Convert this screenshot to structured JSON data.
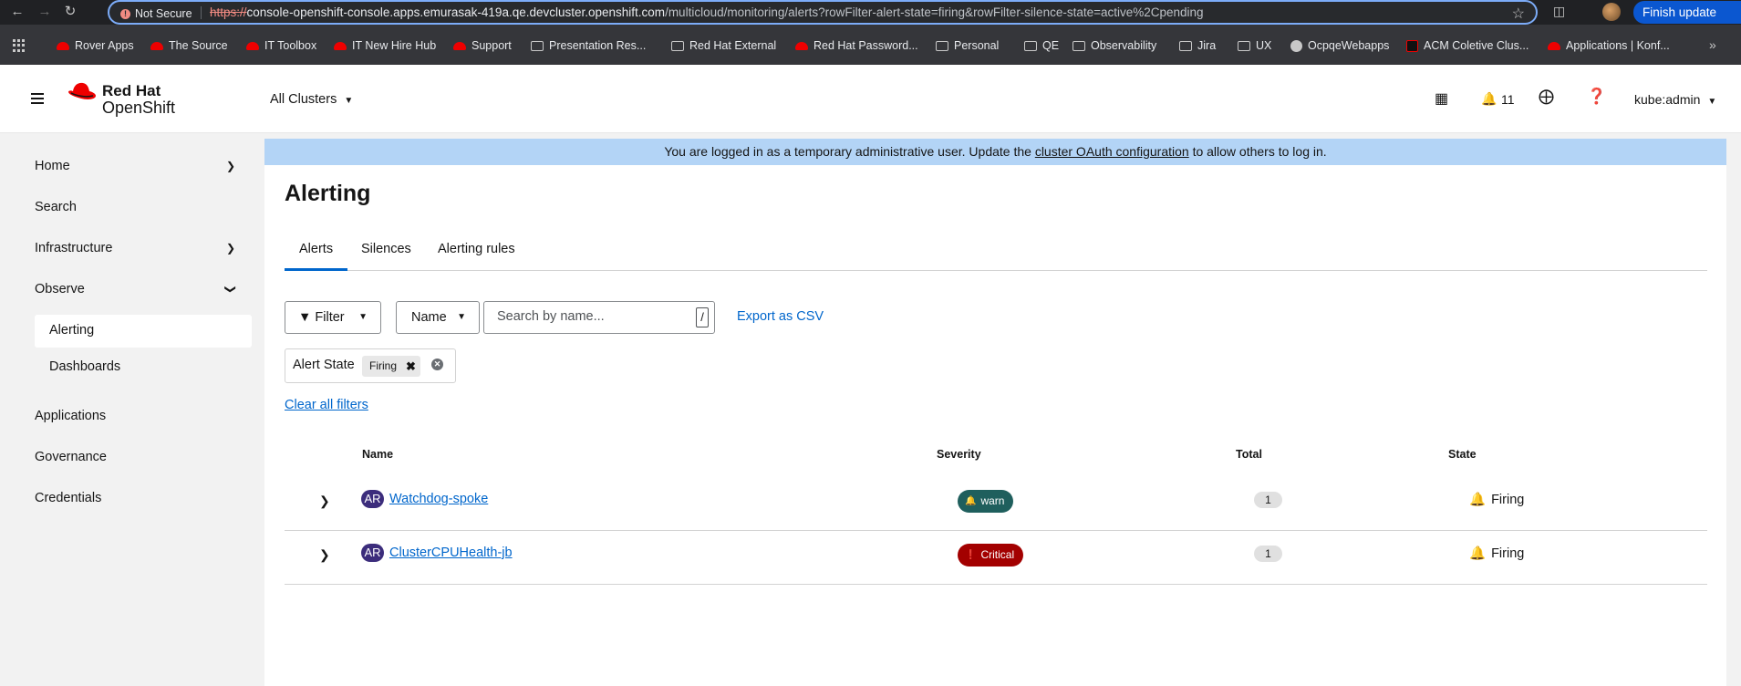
{
  "browser": {
    "security_label": "Not Secure",
    "url_scheme": "https://",
    "url_host": "console-openshift-console.apps.emurasak-419a.qe.devcluster.openshift.com",
    "url_path": "/multicloud/monitoring/alerts?rowFilter-alert-state=firing&rowFilter-silence-state=active%2Cpending",
    "finish_update_label": "Finish update"
  },
  "bookmarks": [
    {
      "label": "Rover Apps",
      "icon": "redhat-icon"
    },
    {
      "label": "The Source",
      "icon": "redhat-icon"
    },
    {
      "label": "IT Toolbox",
      "icon": "redhat-icon"
    },
    {
      "label": "IT New Hire Hub",
      "icon": "redhat-icon"
    },
    {
      "label": "Support",
      "icon": "redhat-icon"
    },
    {
      "label": "Presentation Res...",
      "icon": "folder-icon"
    },
    {
      "label": "Red Hat External",
      "icon": "folder-icon"
    },
    {
      "label": "Red Hat Password...",
      "icon": "redhat-icon"
    },
    {
      "label": "Personal",
      "icon": "folder-icon"
    },
    {
      "label": "QE",
      "icon": "folder-icon"
    },
    {
      "label": "Observability",
      "icon": "folder-icon"
    },
    {
      "label": "Jira",
      "icon": "folder-icon"
    },
    {
      "label": "UX",
      "icon": "folder-icon"
    },
    {
      "label": "OcpqeWebapps",
      "icon": "globe-icon"
    },
    {
      "label": "ACM Coletive Clus...",
      "icon": "acm-icon"
    },
    {
      "label": "Applications | Konf...",
      "icon": "redhat-icon"
    }
  ],
  "masthead": {
    "logo_line1": "Red Hat",
    "logo_line2": "OpenShift",
    "cluster_selector": "All Clusters",
    "notification_count": "11",
    "user": "kube:admin"
  },
  "sidebar": {
    "home": "Home",
    "search": "Search",
    "infrastructure": "Infrastructure",
    "observe": "Observe",
    "alerting": "Alerting",
    "dashboards": "Dashboards",
    "applications": "Applications",
    "governance": "Governance",
    "credentials": "Credentials"
  },
  "banner": {
    "before": "You are logged in as a temporary administrative user. Update the ",
    "link": "cluster OAuth configuration",
    "after": " to allow others to log in."
  },
  "page": {
    "title": "Alerting",
    "tabs": [
      "Alerts",
      "Silences",
      "Alerting rules"
    ]
  },
  "toolbar": {
    "filter_label": "Filter",
    "name_label": "Name",
    "search_placeholder": "Search by name...",
    "search_shortcut": "/",
    "export_label": "Export as CSV"
  },
  "chips": {
    "category": "Alert State",
    "value": "Firing",
    "clear_all": "Clear all filters"
  },
  "table": {
    "columns": [
      "Name",
      "Severity",
      "Total",
      "State"
    ],
    "rows": [
      {
        "badge": "AR",
        "name": "Watchdog-spoke",
        "severity": "warn",
        "total": "1",
        "state": "Firing"
      },
      {
        "badge": "AR",
        "name": "ClusterCPUHealth-jb",
        "severity": "Critical",
        "total": "1",
        "state": "Firing"
      }
    ]
  },
  "colors": {
    "accent": "#0066cc",
    "warn": "#1f5f5d",
    "critical": "#a30000",
    "ar_badge": "#3c2d7c",
    "banner": "#b3d4f6"
  }
}
